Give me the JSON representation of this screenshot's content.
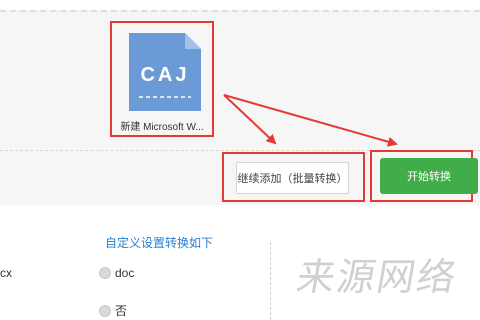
{
  "file": {
    "icon_text": "CAJ",
    "name": "新建 Microsoft W...",
    "icon": "caj-file-icon"
  },
  "buttons": {
    "continue_label": "继续添加（批量转换）",
    "start_label": "开始转换"
  },
  "settings": {
    "title": "自定义设置转换如下",
    "left_partial": "cx",
    "options": [
      {
        "label": "doc",
        "selected": false
      },
      {
        "label": "否",
        "selected": false
      }
    ]
  },
  "watermark": "来源网络",
  "colors": {
    "accent_red": "#e53935",
    "start_green": "#41ad48",
    "link_blue": "#2a7fd4",
    "file_icon_blue": "#6b9bd6"
  }
}
